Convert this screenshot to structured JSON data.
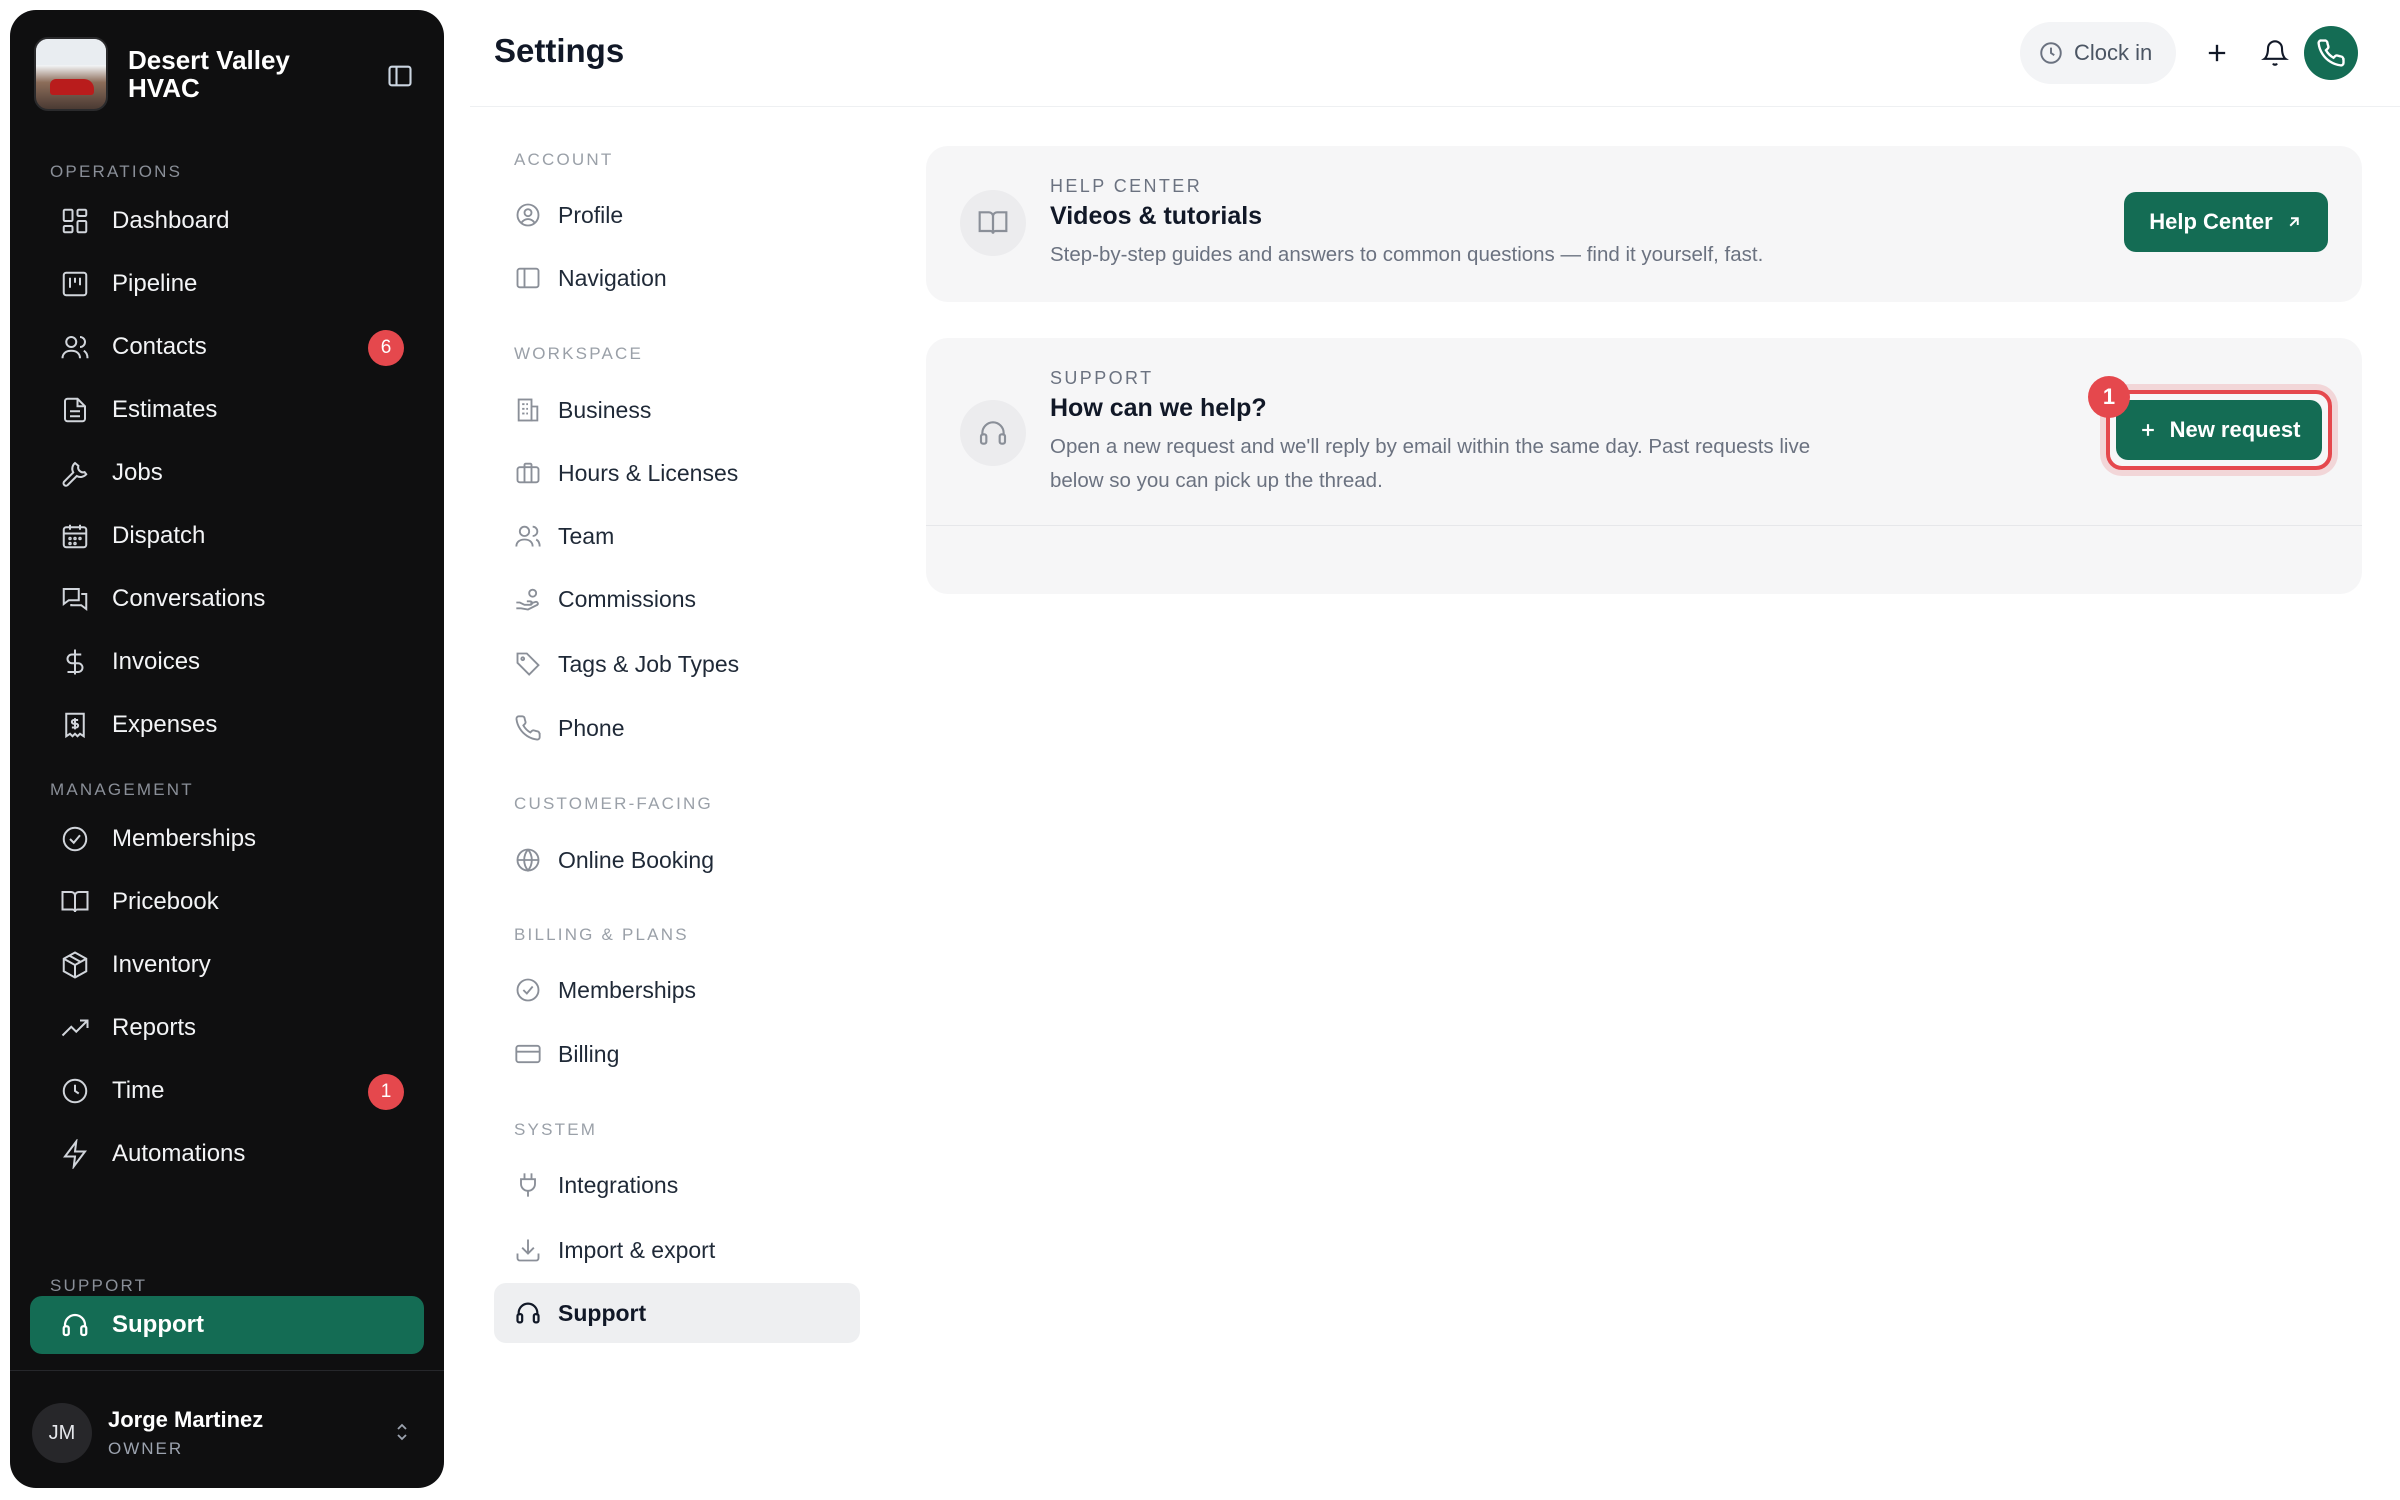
{
  "app": {
    "brand_name": "Desert Valley HVAC",
    "page_title": "Settings"
  },
  "sidebar": {
    "sections": {
      "operations": "OPERATIONS",
      "management": "MANAGEMENT",
      "support": "SUPPORT"
    },
    "operations_items": [
      {
        "label": "Dashboard",
        "icon": "dashboard-icon"
      },
      {
        "label": "Pipeline",
        "icon": "pipeline-icon"
      },
      {
        "label": "Contacts",
        "icon": "contacts-icon",
        "badge": "6"
      },
      {
        "label": "Estimates",
        "icon": "estimates-icon"
      },
      {
        "label": "Jobs",
        "icon": "wrench-icon"
      },
      {
        "label": "Dispatch",
        "icon": "calendar-icon"
      },
      {
        "label": "Conversations",
        "icon": "chat-icon"
      },
      {
        "label": "Invoices",
        "icon": "dollar-icon"
      },
      {
        "label": "Expenses",
        "icon": "receipt-icon"
      }
    ],
    "management_items": [
      {
        "label": "Memberships",
        "icon": "check-badge-icon"
      },
      {
        "label": "Pricebook",
        "icon": "book-icon"
      },
      {
        "label": "Inventory",
        "icon": "box-icon"
      },
      {
        "label": "Reports",
        "icon": "trend-icon"
      },
      {
        "label": "Time",
        "icon": "clock-icon",
        "badge": "1"
      },
      {
        "label": "Automations",
        "icon": "lightning-icon"
      }
    ],
    "support_item": {
      "label": "Support",
      "icon": "headset-icon",
      "active": true
    },
    "user": {
      "initials": "JM",
      "name": "Jorge Martinez",
      "role": "OWNER"
    }
  },
  "topbar": {
    "clock_in_label": "Clock in"
  },
  "settings_nav": {
    "groups": {
      "account": "ACCOUNT",
      "workspace": "WORKSPACE",
      "customer_facing": "CUSTOMER-FACING",
      "billing": "BILLING & PLANS",
      "system": "SYSTEM"
    },
    "items": {
      "profile": "Profile",
      "navigation": "Navigation",
      "business": "Business",
      "hours": "Hours & Licenses",
      "team": "Team",
      "commissions": "Commissions",
      "tags": "Tags & Job Types",
      "phone": "Phone",
      "online_booking": "Online Booking",
      "memberships": "Memberships",
      "billing": "Billing",
      "integrations": "Integrations",
      "import_export": "Import & export",
      "support": "Support"
    },
    "active": "Support"
  },
  "help_center_card": {
    "eyebrow": "HELP CENTER",
    "title": "Videos & tutorials",
    "description": "Step-by-step guides and answers to common questions — find it yourself, fast.",
    "button_label": "Help Center"
  },
  "support_card": {
    "eyebrow": "SUPPORT",
    "title": "How can we help?",
    "description_line1": "Open a new request and we'll reply by email within the same day. Past requests live",
    "description_line2": "below so you can pick up the thread.",
    "button_label": "New request",
    "step_marker": "1"
  },
  "colors": {
    "accent": "#146c54",
    "sidebar_bg": "#0f0f10",
    "badge": "#e5484d",
    "highlight": "#e5484d"
  }
}
